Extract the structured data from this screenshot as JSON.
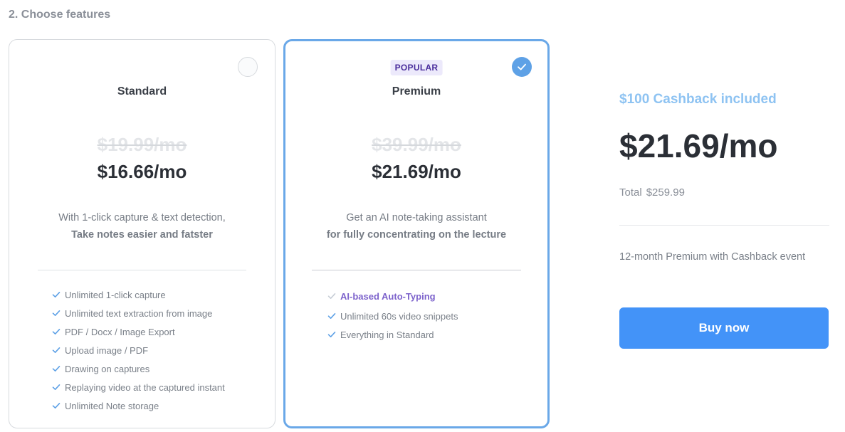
{
  "section": {
    "title": "2. Choose features"
  },
  "plans": {
    "standard": {
      "name": "Standard",
      "old_price": "$19.99/mo",
      "price": "$16.66/mo",
      "desc_line1": "With 1-click capture & text detection,",
      "desc_line2": "Take notes easier and fatster",
      "selected": false,
      "features": [
        "Unlimited 1-click capture",
        "Unlimited text extraction from image",
        "PDF / Docx / Image Export",
        "Upload image / PDF",
        "Drawing on captures",
        "Replaying video at the captured instant",
        "Unlimited Note storage"
      ]
    },
    "premium": {
      "badge": "POPULAR",
      "name": "Premium",
      "old_price": "$39.99/mo",
      "price": "$21.69/mo",
      "desc_line1": "Get an AI note-taking assistant",
      "desc_line2": "for fully concentrating on the lecture",
      "selected": true,
      "features": [
        "AI-based Auto-Typing",
        "Unlimited 60s video snippets",
        "Everything in Standard"
      ]
    }
  },
  "summary": {
    "cashback": "$100 Cashback included",
    "price": "$21.69/mo",
    "total_label": "Total",
    "total_amount": "$259.99",
    "note": "12-month Premium with Cashback event",
    "buy_label": "Buy now"
  },
  "colors": {
    "accent": "#4393f8",
    "selected_border": "#6aa8e8",
    "cashback": "#8ec3f2",
    "highlight_feature": "#7d63cc",
    "badge_bg": "#ece9fb"
  },
  "icons": {
    "check": "check-icon",
    "selected": "checkmark-circle-icon"
  }
}
